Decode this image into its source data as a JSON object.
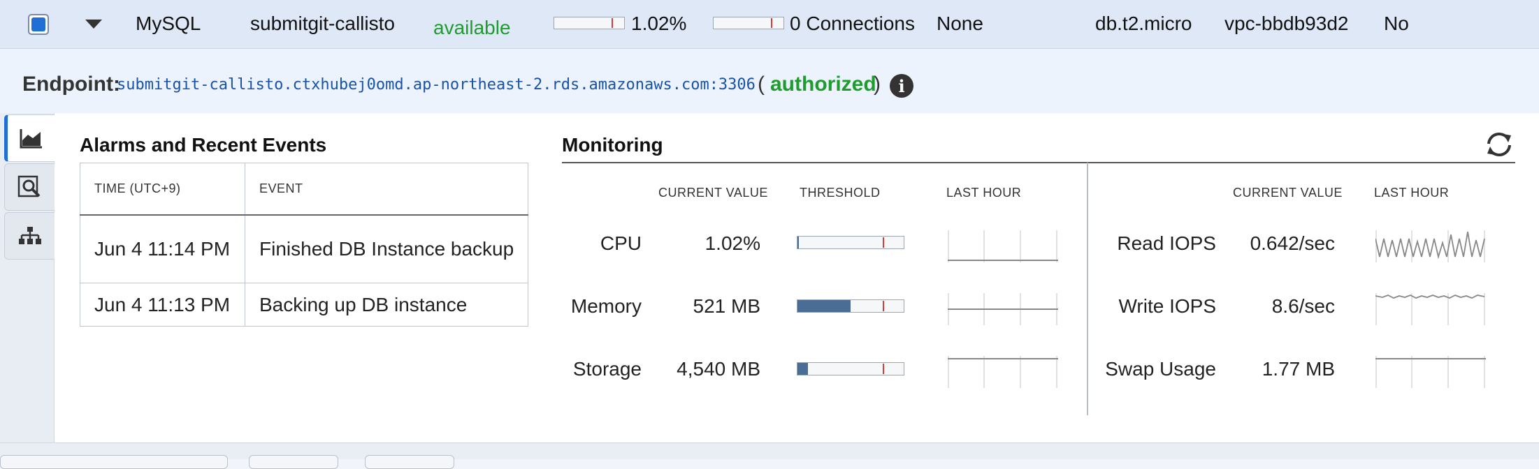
{
  "instance_row": {
    "engine": "MySQL",
    "name": "submitgit-callisto",
    "status": "available",
    "cpu_percent": "1.02%",
    "cpu_level": 0.0102,
    "connections": "0 Connections",
    "replication": "None",
    "instance_class": "db.t2.micro",
    "vpc": "vpc-bbdb93d2",
    "multi_az": "No"
  },
  "endpoint": {
    "label": "Endpoint:",
    "value": "submitgit-callisto.ctxhubej0omd.ap-northeast-2.rds.amazonaws.com:3306",
    "open_paren": "(",
    "auth": "authorized",
    "close_paren": ")"
  },
  "alarms": {
    "title": "Alarms and Recent Events",
    "col_time": "TIME (UTC+9)",
    "col_event": "EVENT",
    "rows": [
      {
        "time": "Jun 4 11:14 PM",
        "event": "Finished DB Instance backup"
      },
      {
        "time": "Jun 4 11:13 PM",
        "event": "Backing up DB instance"
      }
    ]
  },
  "monitoring": {
    "title": "Monitoring",
    "left_headers": {
      "current": "CURRENT VALUE",
      "threshold": "THRESHOLD",
      "last_hour": "LAST HOUR"
    },
    "right_headers": {
      "current": "CURRENT VALUE",
      "last_hour": "LAST HOUR"
    },
    "left_metrics": [
      {
        "label": "CPU",
        "value": "1.02%",
        "fill_fraction": 0.0102
      },
      {
        "label": "Memory",
        "value": "521 MB",
        "fill_fraction": 0.5
      },
      {
        "label": "Storage",
        "value": "4,540 MB",
        "fill_fraction": 0.1
      }
    ],
    "right_metrics": [
      {
        "label": "Read IOPS",
        "value": "0.642/sec"
      },
      {
        "label": "Write IOPS",
        "value": "8.6/sec"
      },
      {
        "label": "Swap Usage",
        "value": "1.77 MB"
      }
    ]
  },
  "colors": {
    "accent": "#1f6fd6",
    "status_green": "#1e9c2e",
    "threshold_mark": "#d83a3a",
    "bar_fill": "#4a6d95"
  },
  "icons": [
    "chevron-down-icon",
    "monitoring-chart-icon",
    "search-log-icon",
    "topology-icon",
    "info-icon",
    "refresh-icon"
  ]
}
